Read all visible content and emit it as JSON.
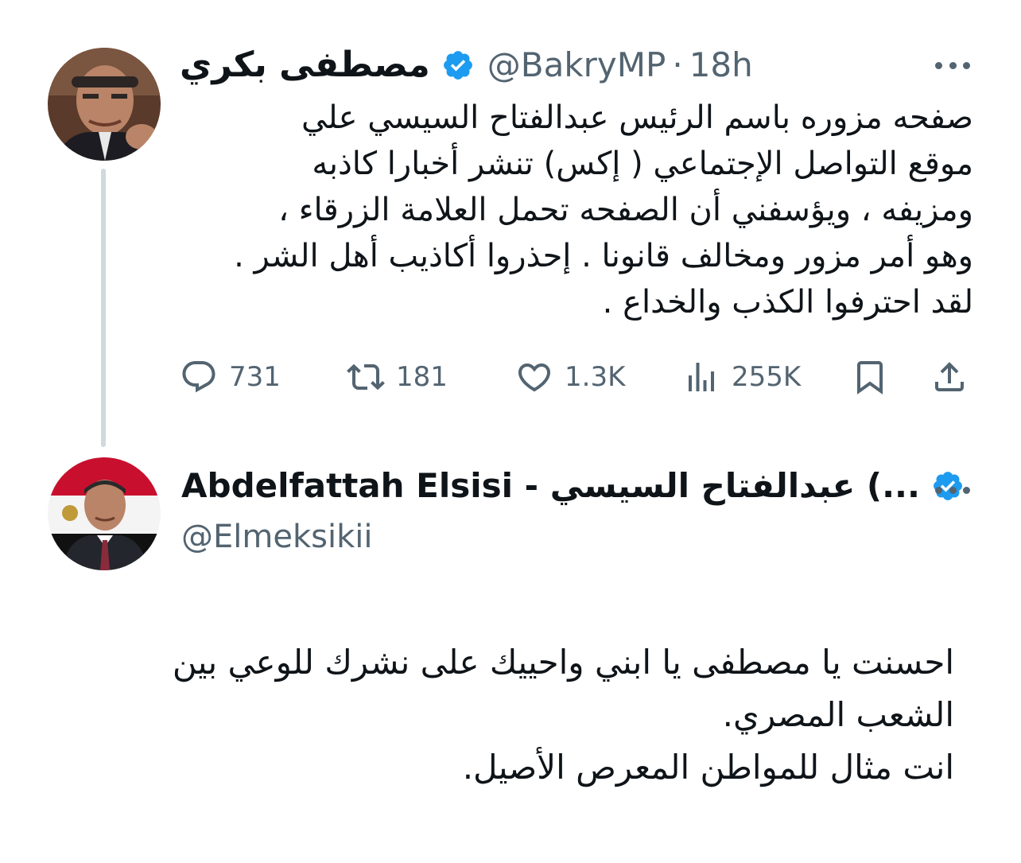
{
  "tweet": {
    "author_name": "مصطفى بكري",
    "handle": "@BakryMP",
    "separator": "·",
    "time": "18h",
    "text": "صفحه مزوره باسم الرئيس عبدالفتاح السيسي علي\nموقع التواصل الإجتماعي ( إكس) تنشر أخبارا كاذبه\nومزيفه ، ويؤسفني أن الصفحه تحمل العلامة الزرقاء ،\nوهو أمر مزور ومخالف قانونا . إحذروا أكاذيب أهل الشر .\nلقد احترفوا الكذب والخداع .",
    "actions": {
      "replies": "731",
      "reposts": "181",
      "likes": "1.3K",
      "views": "255K"
    }
  },
  "reply": {
    "author_name": "Abdelfattah Elsisi - عبدالفتاح السيسي (...",
    "handle": "@Elmeksikii",
    "text": "احسنت يا مصطفى يا ابني واحييك على نشرك للوعي بين\nالشعب المصري.\nانت مثال للمواطن المعرص الأصيل."
  },
  "colors": {
    "verified_blue": "#1d9bf0",
    "secondary_text": "#536471",
    "thread_line": "#cfd9de"
  },
  "icons": [
    "more-icon",
    "verified-icon",
    "reply-icon",
    "repost-icon",
    "like-icon",
    "views-icon",
    "bookmark-icon",
    "share-icon"
  ]
}
